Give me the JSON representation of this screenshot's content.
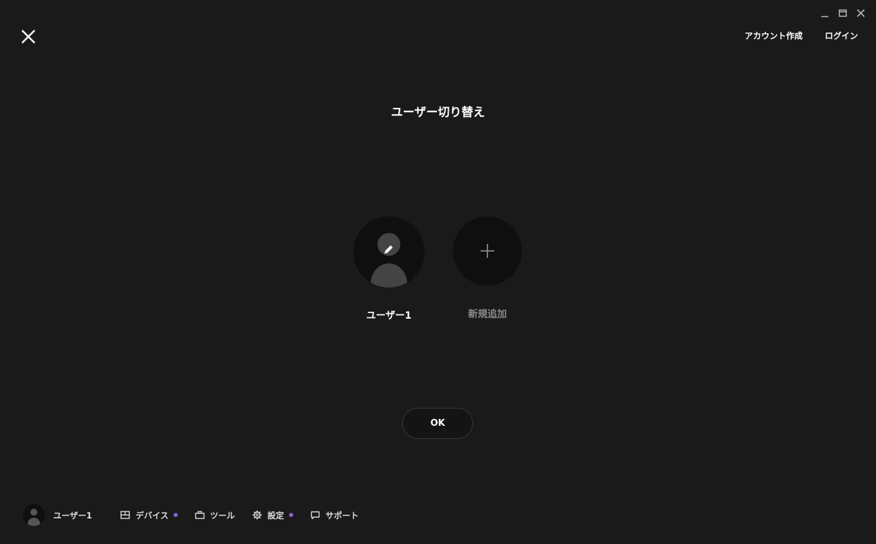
{
  "window": {
    "minimize_icon": "minimize-icon",
    "maximize_icon": "maximize-icon",
    "close_icon": "window-close-icon"
  },
  "header": {
    "close_icon": "close-icon",
    "create_account": "アカウント作成",
    "login": "ログイン"
  },
  "main": {
    "title": "ユーザー切り替え",
    "users": [
      {
        "name": "ユーザー1",
        "icon": "edit-icon"
      }
    ],
    "add_new": {
      "label": "新規追加",
      "icon": "plus-icon"
    },
    "ok_label": "OK"
  },
  "bottom_bar": {
    "username": "ユーザー1",
    "items": [
      {
        "label": "デバイス",
        "icon": "device-icon",
        "badge": true
      },
      {
        "label": "ツール",
        "icon": "toolbox-icon",
        "badge": false
      },
      {
        "label": "設定",
        "icon": "gear-icon",
        "badge": true
      },
      {
        "label": "サポート",
        "icon": "chat-icon",
        "badge": false
      }
    ]
  },
  "colors": {
    "background": "#1a1a1a",
    "accent_dot": "#8a63d2",
    "circle_bg": "#0f0f0f"
  }
}
